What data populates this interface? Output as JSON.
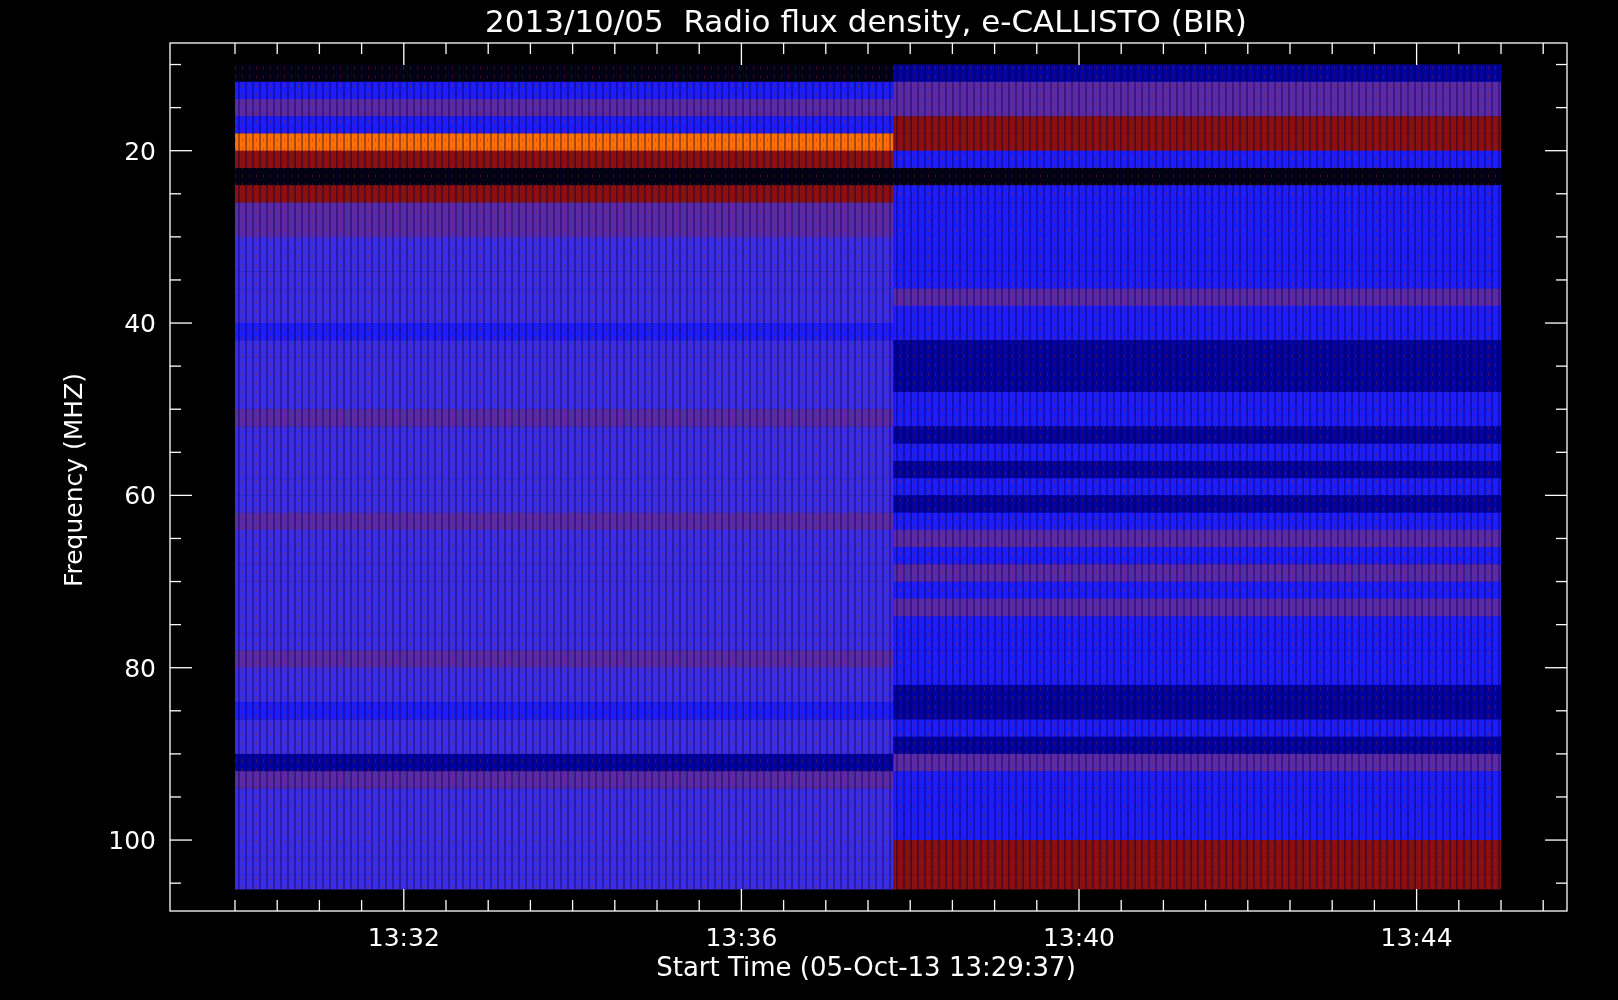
{
  "title": "2013/10/05  Radio flux density, e-CALLISTO (BIR)",
  "x_axis": {
    "label": "Start Time (05-Oct-13 13:29:37)",
    "ticks": [
      "13:32",
      "13:36",
      "13:40",
      "13:44"
    ]
  },
  "y_axis": {
    "label": "Frequency (MHZ)",
    "ticks": [
      "20",
      "40",
      "60",
      "80",
      "100"
    ]
  }
}
